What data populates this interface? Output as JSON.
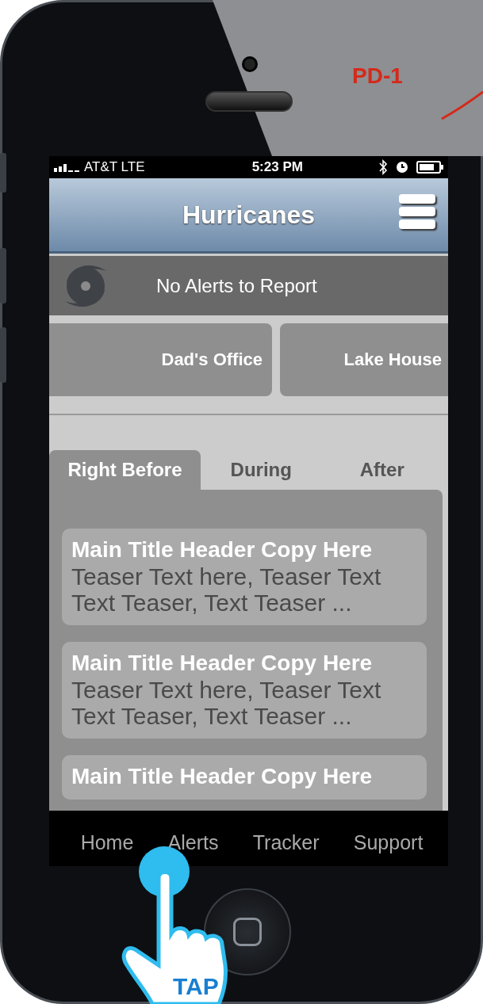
{
  "annotation": {
    "label": "PD-1"
  },
  "status_bar": {
    "carrier": "AT&T LTE",
    "time": "5:23 PM"
  },
  "header": {
    "title": "Hurricanes"
  },
  "alert_bar": {
    "text": "No Alerts to Report"
  },
  "locations": [
    {
      "name": "Dad's Office"
    },
    {
      "name": "Lake House"
    }
  ],
  "tabs": [
    {
      "label": "Right Before",
      "selected": true
    },
    {
      "label": "During",
      "selected": false
    },
    {
      "label": "After",
      "selected": false
    }
  ],
  "articles": [
    {
      "title": "Main Title Header Copy Here",
      "teaser": "Teaser Text here, Teaser Text Text Teaser, Text Teaser ..."
    },
    {
      "title": "Main Title Header Copy Here",
      "teaser": "Teaser Text here, Teaser Text Text Teaser, Text Teaser ..."
    },
    {
      "title": "Main Title Header Copy Here"
    }
  ],
  "bottom_nav": [
    {
      "label": "Home"
    },
    {
      "label": "Alerts"
    },
    {
      "label": "Tracker"
    },
    {
      "label": "Support"
    }
  ],
  "gesture": {
    "label": "TAP"
  }
}
